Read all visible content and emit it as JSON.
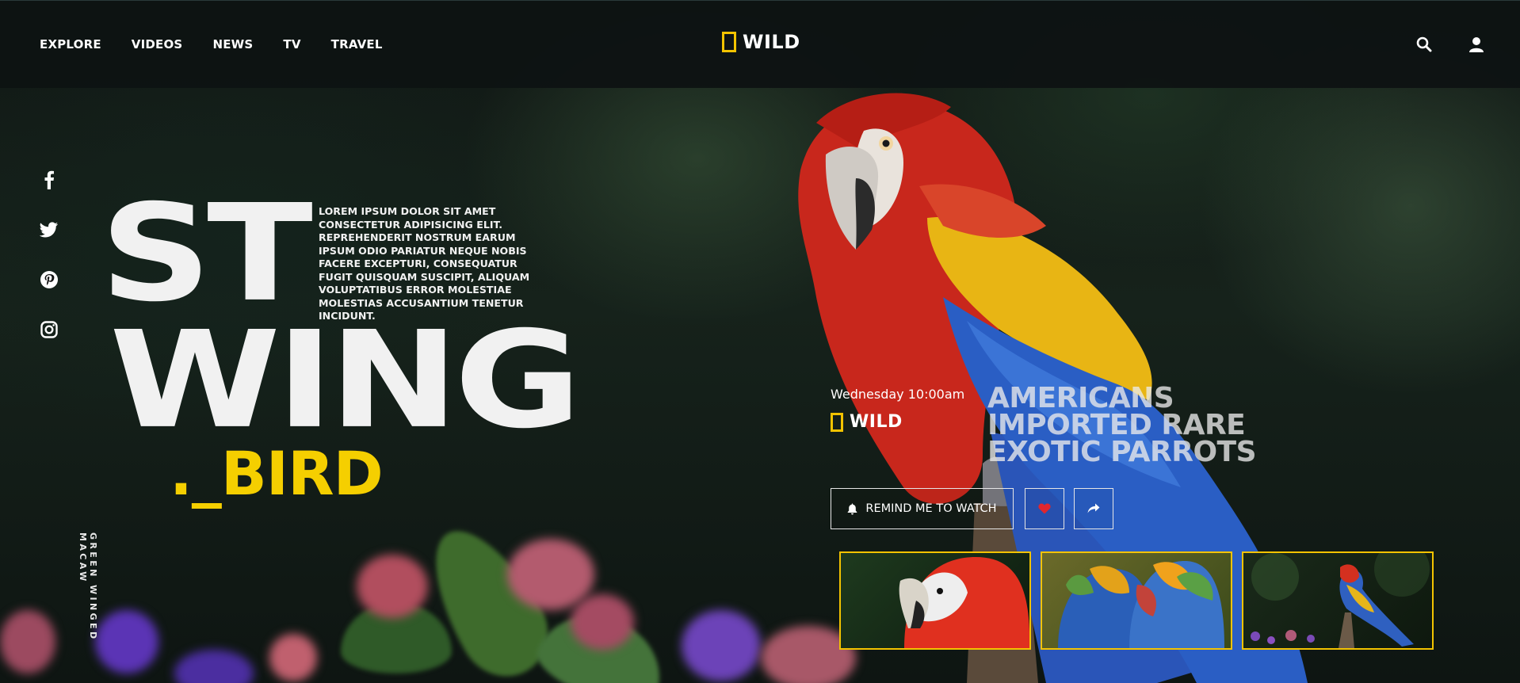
{
  "nav": {
    "items": [
      "EXPLORE",
      "VIDEOS",
      "NEWS",
      "TV",
      "TRAVEL"
    ]
  },
  "brand": {
    "name": "WILD",
    "accent": "#f3c300"
  },
  "header_icons": [
    "search-icon",
    "user-icon"
  ],
  "social": [
    "facebook-icon",
    "twitter-icon",
    "pinterest-icon",
    "instagram-icon"
  ],
  "hero": {
    "title_line1": "ST",
    "title_line2": "WING",
    "title_line3": "._BIRD",
    "title_accent": "#f5cf00",
    "intro": "LOREM IPSUM DOLOR SIT AMET CONSECTETUR ADIPISICING ELIT. REPREHENDERIT NOSTRUM EARUM IPSUM ODIO PARIATUR NEQUE NOBIS FACERE EXCEPTURI, CONSEQUATUR FUGIT QUISQUAM SUSCIPIT, ALIQUAM VOLUPTATIBUS ERROR MOLESTIAE MOLESTIAS ACCUSANTIUM TENETUR INCIDUNT.",
    "species": "GREEN WINGED MACAW"
  },
  "show": {
    "schedule": "Wednesday 10:00am",
    "channel": "WILD",
    "headline_lines": [
      "AMERICANS",
      "IMPORTED RARE",
      "EXOTIC PARROTS"
    ],
    "remind_label": "REMIND ME TO WATCH",
    "like_color": "#e0262e"
  },
  "thumbnails": [
    "scarlet-macaw-closeup",
    "pair-of-blue-macaws",
    "macaw-on-perch"
  ]
}
